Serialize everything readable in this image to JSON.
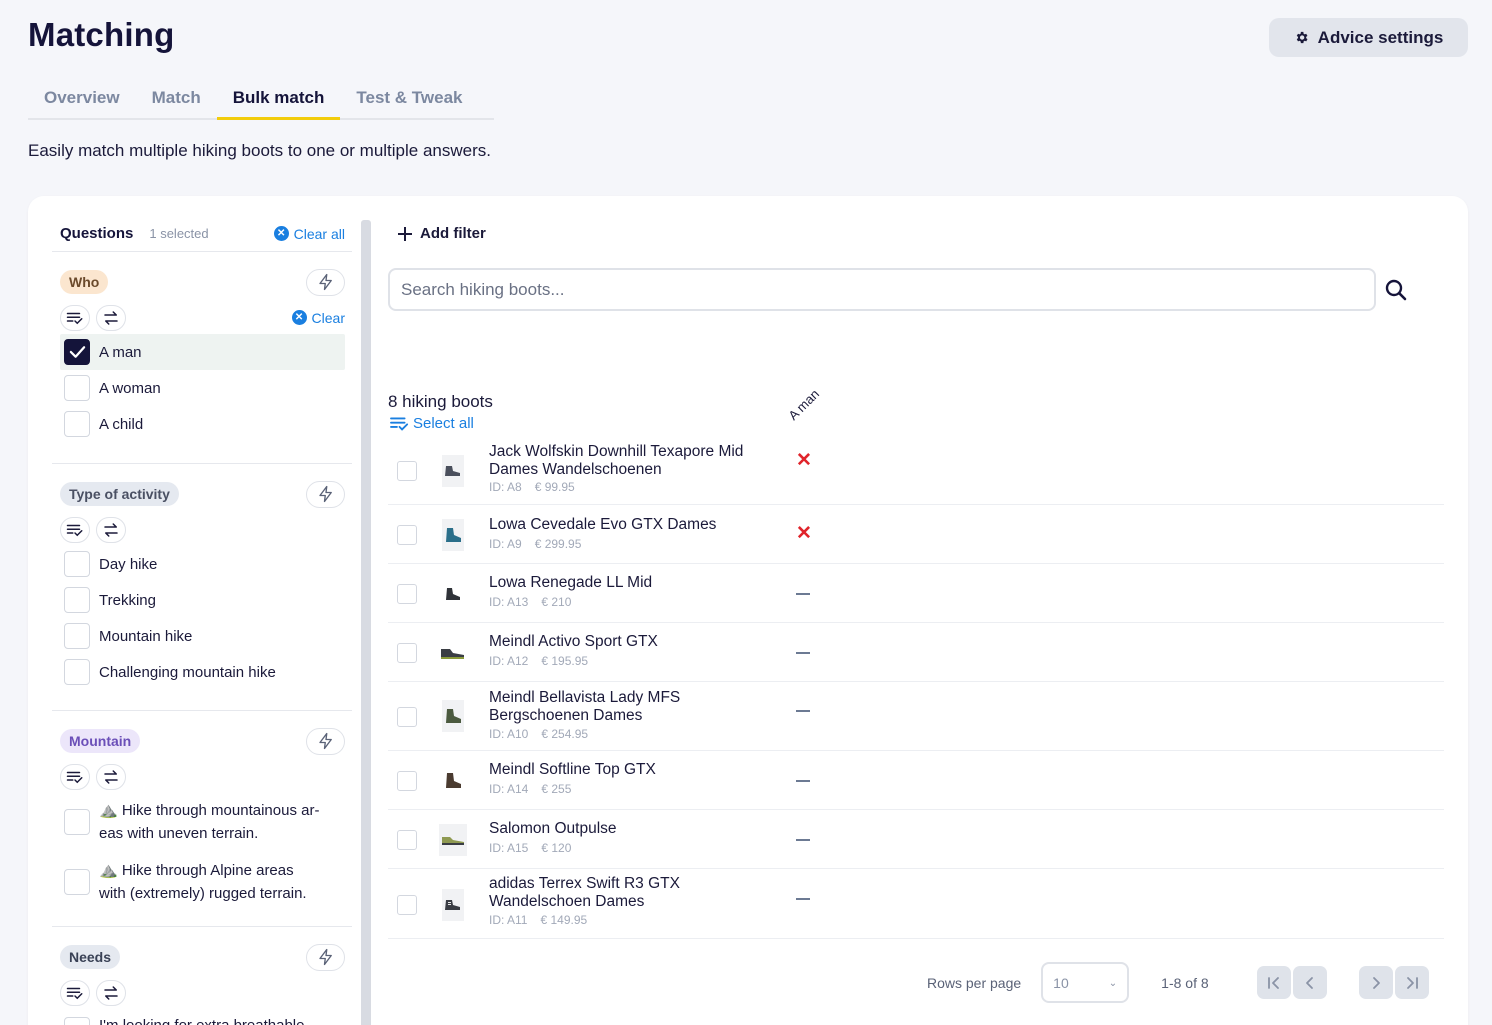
{
  "header": {
    "title": "Matching",
    "advice_settings_label": "Advice settings"
  },
  "tabs": [
    {
      "label": "Overview",
      "active": false
    },
    {
      "label": "Match",
      "active": false
    },
    {
      "label": "Bulk match",
      "active": true
    },
    {
      "label": "Test & Tweak",
      "active": false
    }
  ],
  "subtitle": "Easily match multiple hiking boots to one or multiple answers.",
  "questions": {
    "title": "Questions",
    "selected_count": "1 selected",
    "clear_all_label": "Clear all",
    "clear_label": "Clear",
    "groups": [
      {
        "name": "Who",
        "options": [
          {
            "label": "A man",
            "checked": true
          },
          {
            "label": "A woman",
            "checked": false
          },
          {
            "label": "A child",
            "checked": false
          }
        ]
      },
      {
        "name": "Type of activity",
        "options": [
          {
            "label": "Day hike",
            "checked": false
          },
          {
            "label": "Trekking",
            "checked": false
          },
          {
            "label": "Mountain hike",
            "checked": false
          },
          {
            "label": "Challenging mountain hike",
            "checked": false
          }
        ]
      },
      {
        "name": "Mountain",
        "options": [
          {
            "label": "⛰️ Hike through mountainous ar-eas with uneven terrain.",
            "line1": "⛰️ Hike through mountainous ar-",
            "line2": "eas with uneven terrain.",
            "checked": false
          },
          {
            "label": "⛰️ Hike through Alpine areas with (extremely) rugged terrain.",
            "line1": "⛰️ Hike through Alpine areas",
            "line2": "with (extremely) rugged terrain.",
            "checked": false
          }
        ]
      },
      {
        "name": "Needs",
        "options": [
          {
            "label": "I'm looking for extra breathable",
            "checked": false
          }
        ]
      }
    ]
  },
  "products": {
    "add_filter_label": "Add filter",
    "search_placeholder": "Search hiking boots...",
    "count_label": "8 hiking boots",
    "select_all_label": "Select all",
    "column_header": "A man",
    "rows": [
      {
        "name": "Jack Wolfskin Downhill Texapore Mid Dames Wandelschoenen",
        "id": "ID: A8",
        "price": "€ 99.95",
        "status": "x"
      },
      {
        "name": "Lowa Cevedale Evo GTX Dames",
        "id": "ID: A9",
        "price": "€ 299.95",
        "status": "x"
      },
      {
        "name": "Lowa Renegade LL Mid",
        "id": "ID: A13",
        "price": "€ 210",
        "status": "dash"
      },
      {
        "name": "Meindl Activo Sport GTX",
        "id": "ID: A12",
        "price": "€ 195.95",
        "status": "dash"
      },
      {
        "name": "Meindl Bellavista Lady MFS Bergschoenen Dames",
        "id": "ID: A10",
        "price": "€ 254.95",
        "status": "dash"
      },
      {
        "name": "Meindl Softline Top GTX",
        "id": "ID: A14",
        "price": "€ 255",
        "status": "dash"
      },
      {
        "name": "Salomon Outpulse",
        "id": "ID: A15",
        "price": "€ 120",
        "status": "dash"
      },
      {
        "name": "adidas Terrex Swift R3 GTX Wandelschoen Dames",
        "id": "ID: A11",
        "price": "€ 149.95",
        "status": "dash"
      }
    ]
  },
  "pagination": {
    "rows_per_page_label": "Rows per page",
    "rows_per_page_value": "10",
    "range": "1-8 of 8"
  },
  "colors": {
    "accent_blue": "#1a7fe0",
    "tab_underline": "#f2cc0c",
    "unmatched_red": "#e0242b",
    "checkbox_checked": "#14143a"
  }
}
